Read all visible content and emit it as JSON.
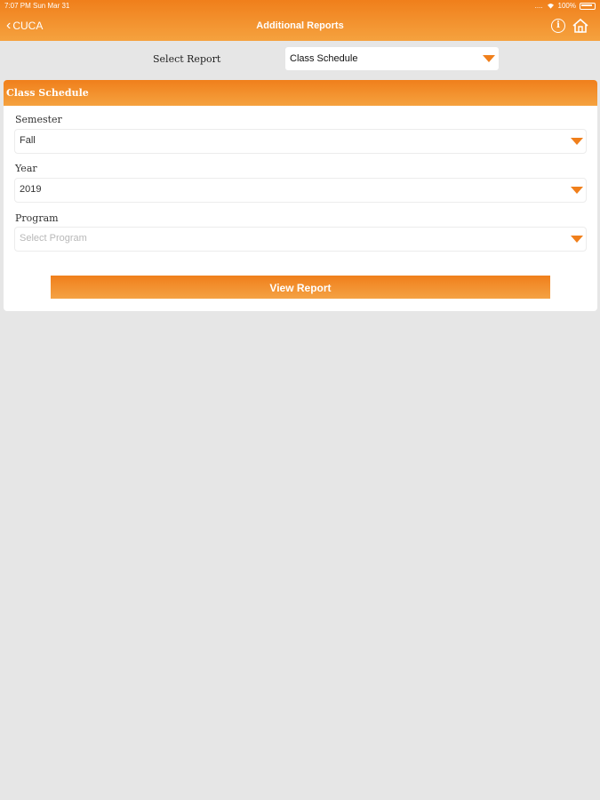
{
  "status_bar": {
    "time": "7:07 PM   Sun Mar 31",
    "signal_text": "....",
    "battery": "100%"
  },
  "nav": {
    "back_label": "CUCA",
    "title": "Additional Reports"
  },
  "report_selector": {
    "label": "Select Report",
    "value": "Class Schedule"
  },
  "card": {
    "title": "Class Schedule",
    "fields": [
      {
        "label": "Semester",
        "value": "Fall",
        "is_placeholder": false
      },
      {
        "label": "Year",
        "value": "2019",
        "is_placeholder": false
      },
      {
        "label": "Program",
        "value": "Select Program",
        "is_placeholder": true
      }
    ],
    "button_label": "View Report"
  },
  "colors": {
    "accent": "#f07f1b",
    "accent_light": "#f5a23f",
    "background": "#e6e6e6",
    "placeholder": "#b8b8b8"
  },
  "icons": {
    "back": "chevron-left-icon",
    "info": "info-icon",
    "home": "home-icon",
    "dropdown": "caret-down-icon",
    "wifi": "wifi-icon",
    "battery": "battery-icon"
  }
}
